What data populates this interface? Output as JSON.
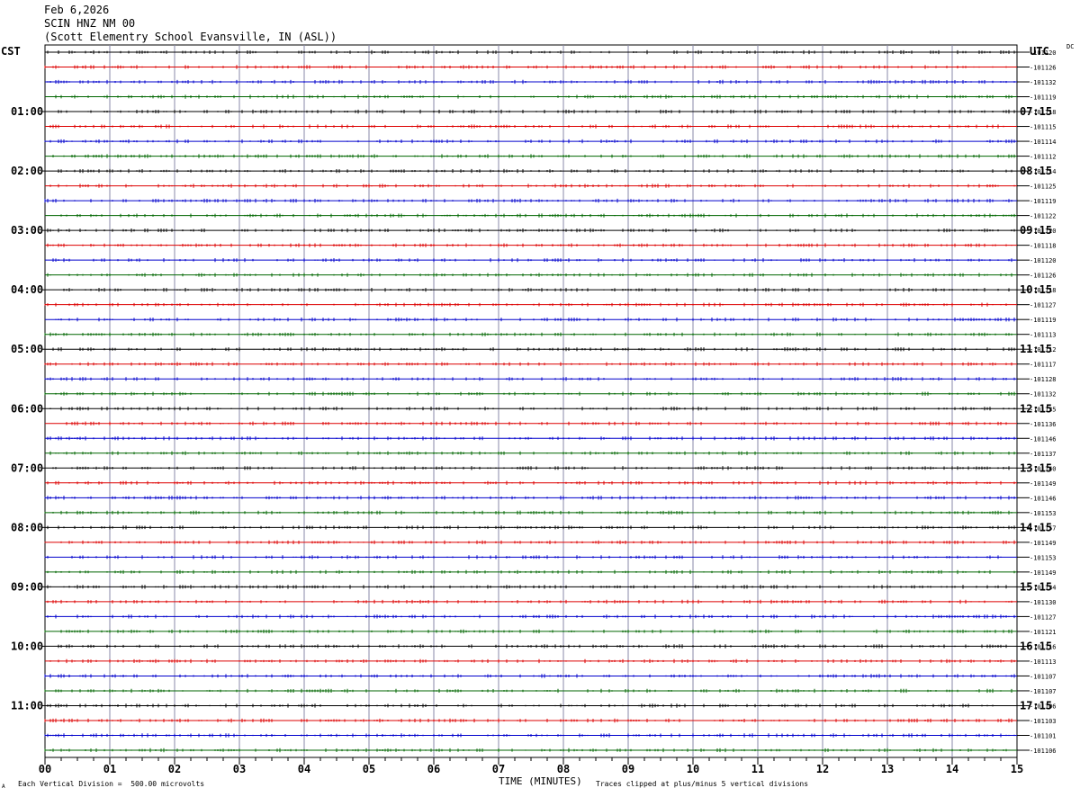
{
  "header": {
    "date": "Feb 6,2026",
    "station": "SCIN HNZ NM 00",
    "location": "(Scott Elementry School Evansville, IN (ASL))"
  },
  "left_timezone": "CST",
  "right_timezone": "UTC",
  "dc_label": "DC",
  "footer": {
    "scale_note": "Each Vertical Division =  500.00 microvolts",
    "clip_note": "Traces clipped at plus/minus 5 vertical divisions",
    "corner_mark": "A"
  },
  "chart_data": {
    "type": "line",
    "title": "SCIN HNZ NM 00",
    "xlabel": "TIME (MINUTES)",
    "xlim": [
      0,
      15
    ],
    "x_ticks": [
      "00",
      "01",
      "02",
      "03",
      "04",
      "05",
      "06",
      "07",
      "08",
      "09",
      "10",
      "11",
      "12",
      "13",
      "14",
      "15"
    ],
    "left_hour_labels": [
      "01:00",
      "02:00",
      "03:00",
      "04:00",
      "05:00",
      "06:00",
      "07:00",
      "08:00",
      "09:00",
      "10:00",
      "11:00"
    ],
    "right_hour_labels": [
      "07:15",
      "08:15",
      "09:15",
      "10:15",
      "11:15",
      "12:15",
      "13:15",
      "14:15",
      "15:15",
      "16:15",
      "17:15"
    ],
    "trace_colors": [
      "#000000",
      "#dd0000",
      "#0000cc",
      "#006600"
    ],
    "dc_offsets": [
      "-101120",
      "-101126",
      "-101132",
      "-101119",
      "-101118",
      "-101115",
      "-101114",
      "-101112",
      "-101114",
      "-101125",
      "-101119",
      "-101122",
      "-101120",
      "-101118",
      "-101120",
      "-101126",
      "-101118",
      "-101127",
      "-101119",
      "-101113",
      "-101112",
      "-101117",
      "-101128",
      "-101132",
      "-101135",
      "-101136",
      "-101146",
      "-101137",
      "-101140",
      "-101149",
      "-101146",
      "-101153",
      "-101157",
      "-101149",
      "-101153",
      "-101149",
      "-101134",
      "-101130",
      "-101127",
      "-101121",
      "-101116",
      "-101113",
      "-101107",
      "-101107",
      "-101106",
      "-101103",
      "-101101",
      "-101106"
    ],
    "scale_microvolts_per_division": 500.0,
    "clip_divisions": 5
  }
}
